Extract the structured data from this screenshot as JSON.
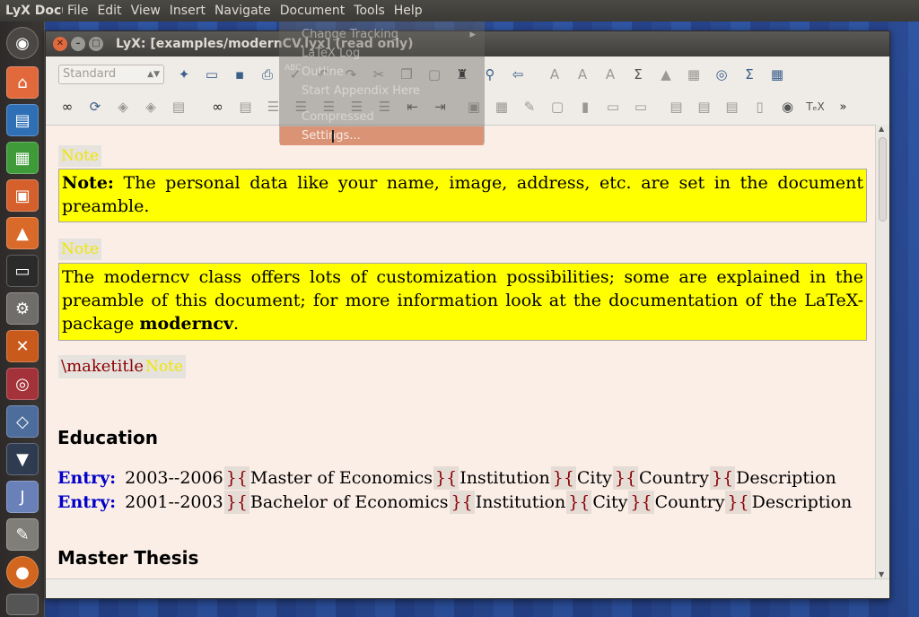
{
  "top_panel": {
    "app_name": "LyX Document",
    "menus": [
      "File",
      "Edit",
      "View",
      "Insert",
      "Navigate",
      "Document",
      "Tools",
      "Help"
    ]
  },
  "window": {
    "title": "LyX: [examples/modernCV.lyx] (read only)"
  },
  "toolbar": {
    "paragraph_style": "Standard"
  },
  "dropdown": {
    "items": [
      "Change Tracking",
      "LaTeX Log",
      "Outline",
      "Start Appendix Here",
      "Compressed",
      "Settings..."
    ],
    "highlighted": "Settings..."
  },
  "document": {
    "note_tag": "Note",
    "note1_bold": "Note:",
    "note1_text": " The personal data like your name, image, address, etc. are set in the document preamble.",
    "note2_text_a": "The moderncv class offers lots of customization possibilities; some are explained in the preamble of this document; for more information look at the documentation of the LaTeX-package ",
    "note2_bold": "moderncv",
    "note2_text_b": ".",
    "maketitle": "\\maketitle",
    "section_education": "Education",
    "entry_label": "Entry:",
    "separator_glyph": "}{",
    "entries": [
      {
        "dates": "2003--2006",
        "degree": "Master of Economics",
        "institution": "Institution",
        "city": "City",
        "country": "Country",
        "description": "Description"
      },
      {
        "dates": "2001--2003",
        "degree": "Bachelor of Economics",
        "institution": "Institution",
        "city": "City",
        "country": "Country",
        "description": "Description"
      }
    ],
    "section_thesis": "Master Thesis"
  },
  "colors": {
    "note_background": "#ffff00",
    "entry_label": "#0000c8",
    "ert_text": "#8b0000",
    "document_background": "#fbeee7",
    "menu_highlight": "#f07746"
  }
}
